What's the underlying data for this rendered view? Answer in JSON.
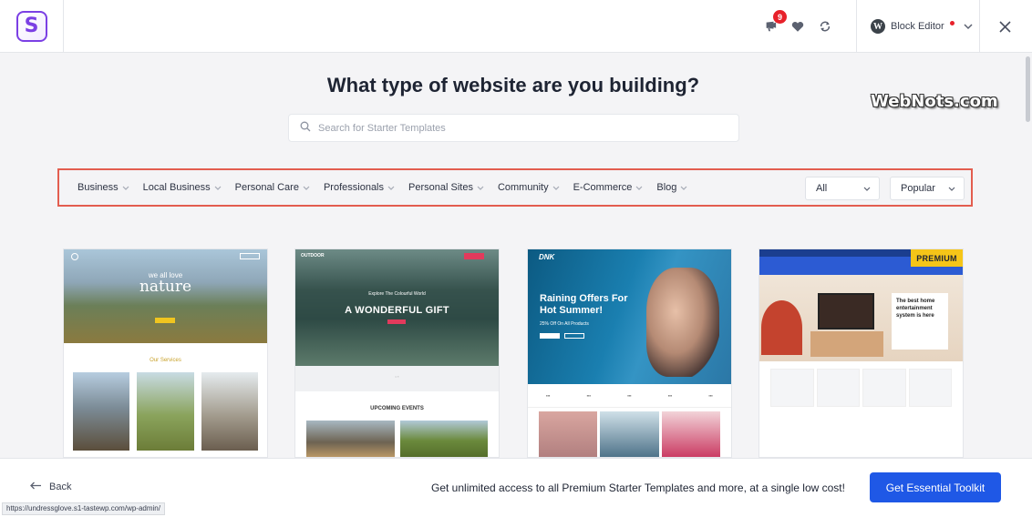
{
  "topbar": {
    "notifications_count": "9",
    "editor_label": "Block Editor",
    "wp_glyph": "W"
  },
  "main": {
    "heading": "What type of website are you building?",
    "watermark": "WebNots.com",
    "search_placeholder": "Search for Starter Templates"
  },
  "filters": {
    "categories": [
      "Business",
      "Local Business",
      "Personal Care",
      "Professionals",
      "Personal Sites",
      "Community",
      "E-Commerce",
      "Blog"
    ],
    "type_selected": "All",
    "sort_selected": "Popular"
  },
  "templates": [
    {
      "hero_small": "we all love",
      "hero_big": "nature",
      "section": "Our Services"
    },
    {
      "logo": "OUTDOOR",
      "tagline": "Explore The Colourful World",
      "headline": "A WONDERFUL GIFT",
      "events": "UPCOMING EVENTS"
    },
    {
      "logo": "DNK",
      "headline_1": "Raining Offers For",
      "headline_2": "Hot Summer!",
      "sub": "25% Off On All Products"
    },
    {
      "badge": "PREMIUM",
      "box_text": "The best home entertainment system is here"
    }
  ],
  "bottombar": {
    "back_label": "Back",
    "promo": "Get unlimited access to all Premium Starter Templates and more, at a single low cost!",
    "cta_label": "Get Essential Toolkit",
    "status_url": "https://undressglove.s1-tastewp.com/wp-admin/"
  },
  "colors": {
    "accent": "#1f58e6",
    "brand": "#7b3fe4",
    "highlight_border": "#e35d4f",
    "premium": "#f5c518"
  }
}
